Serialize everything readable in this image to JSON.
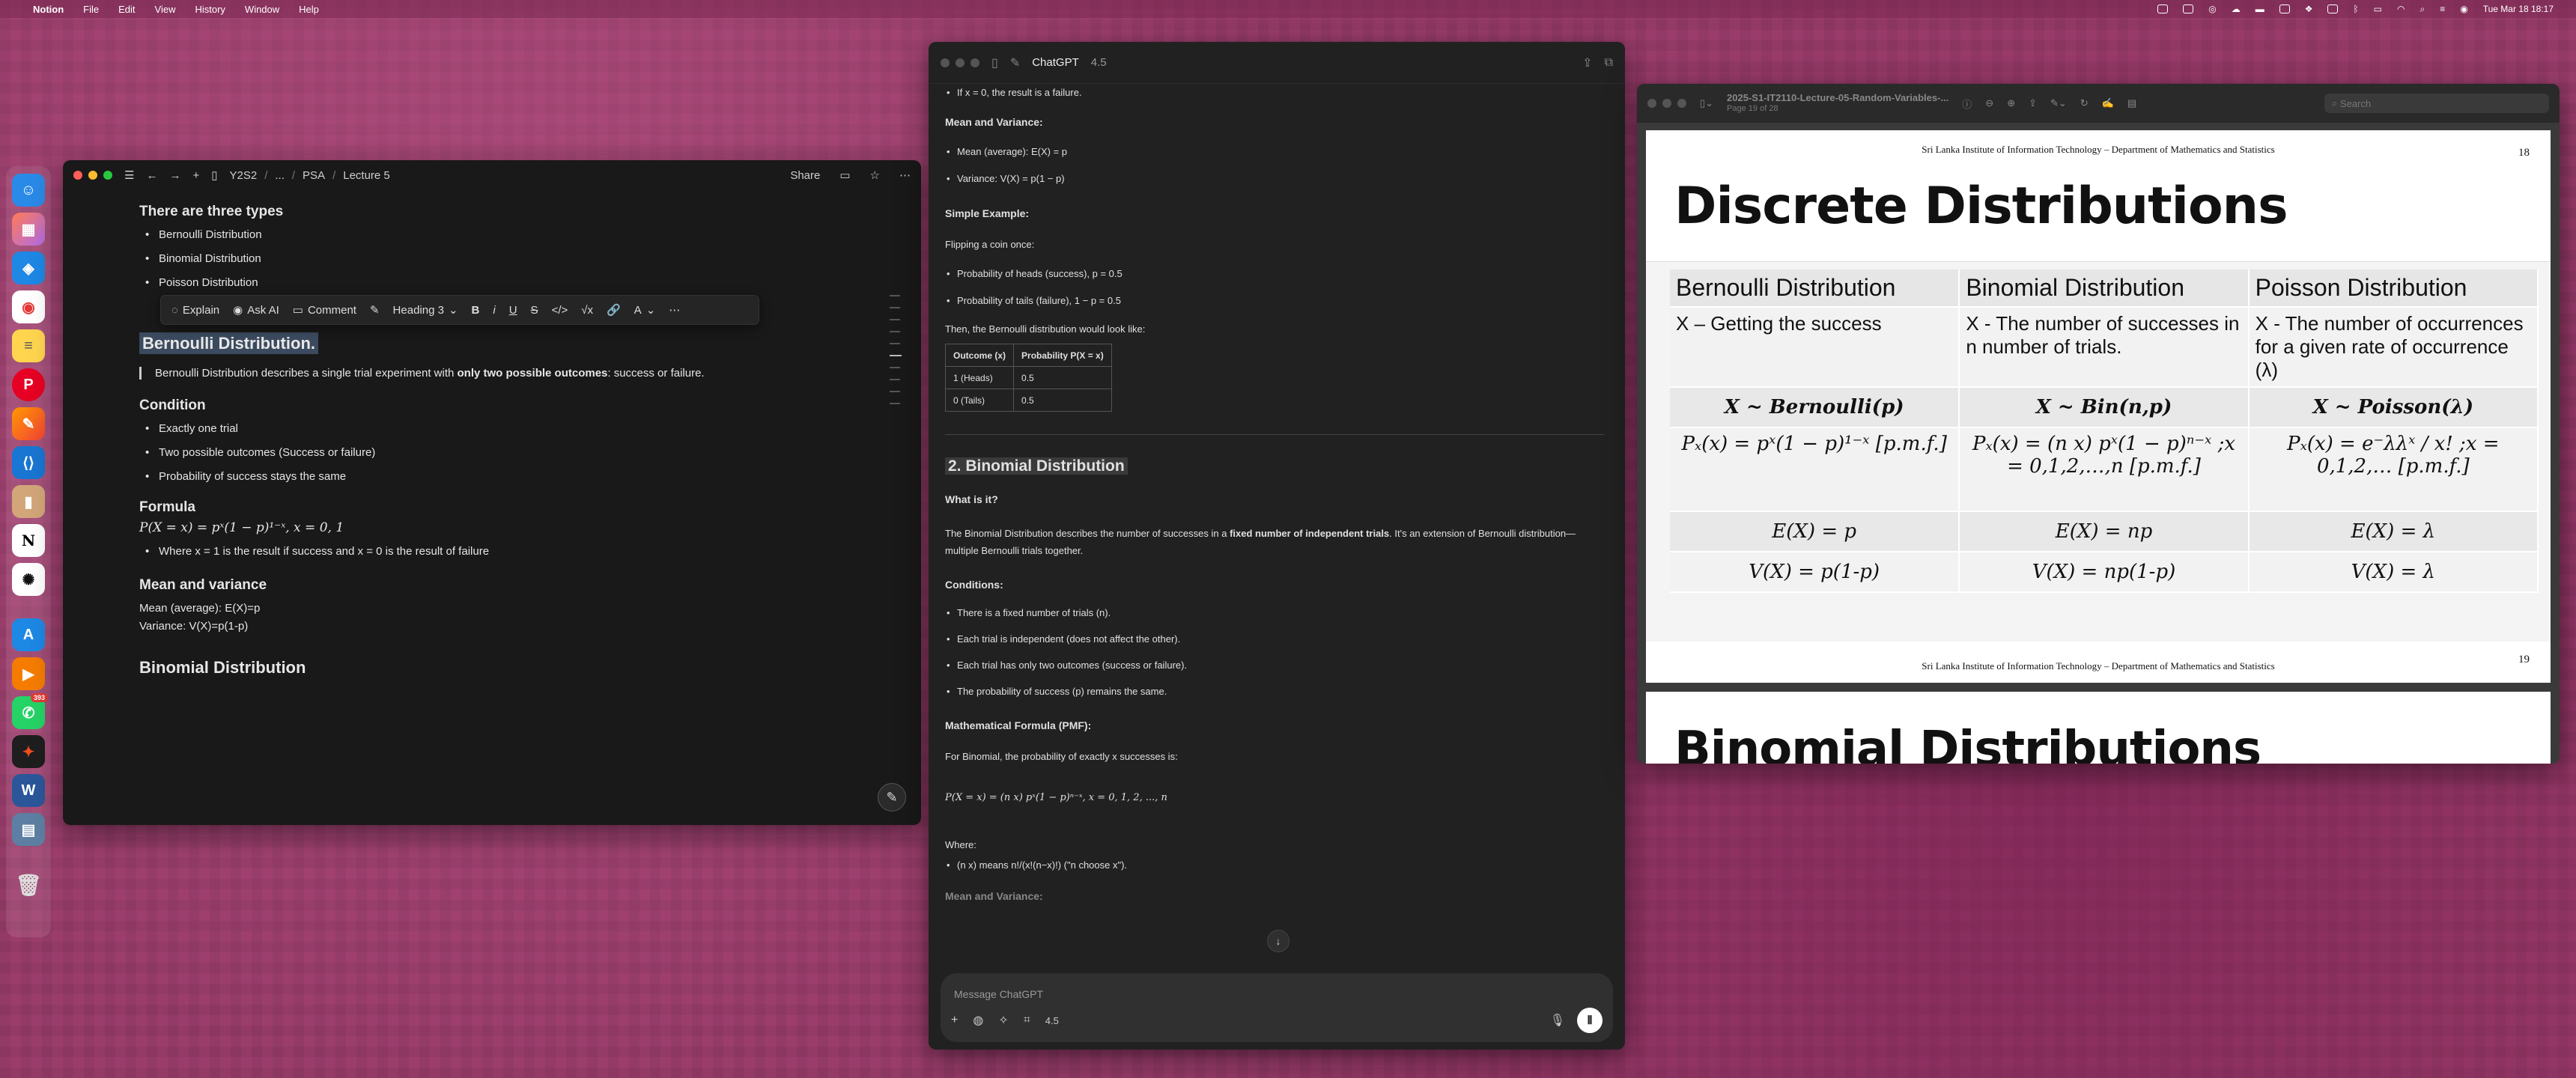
{
  "menubar": {
    "apple": "",
    "app": "Notion",
    "menus": [
      "File",
      "Edit",
      "View",
      "History",
      "Window",
      "Help"
    ],
    "clock": "Tue Mar 18  18:17"
  },
  "dock": {
    "items": [
      "finder",
      "launchpad",
      "safari",
      "chrome",
      "notes",
      "pinterest",
      "pages",
      "vscode",
      "notebook",
      "notion",
      "chatgpt",
      "appstore",
      "clapper",
      "whatsapp",
      "figma",
      "word",
      "preview",
      "trash"
    ],
    "whatsapp_badge": "393"
  },
  "notion": {
    "breadcrumb": [
      "Y2S2",
      "...",
      "PSA",
      "Lecture 5"
    ],
    "share": "Share",
    "heading_types": "There are three types",
    "types": [
      "Bernoulli Distribution",
      "Binomial Distribution",
      "Poisson Distribution"
    ],
    "toolbar": {
      "explain": "Explain",
      "ask_ai": "Ask AI",
      "comment": "Comment",
      "block": "Heading 3",
      "bold": "B",
      "italic": "i",
      "underline": "U",
      "strike": "S",
      "code": "</>",
      "eq": "√x",
      "color": "A"
    },
    "selected_heading": "Bernoulli Distribution.",
    "quote_pre": "Bernoulli Distribution describes a single trial experiment with ",
    "quote_bold": "only two possible outcomes",
    "quote_post": ": success or failure.",
    "condition_heading": "Condition",
    "conditions": [
      "Exactly one trial",
      "Two possible outcomes (Success or failure)",
      "Probability of success stays the same"
    ],
    "formula_heading": "Formula",
    "formula": "P(X = x) = pˣ(1 − p)¹⁻ˣ,    x = 0, 1",
    "formula_note": "Where x = 1 is the result if success and x = 0 is the result of failure",
    "mv_heading": "Mean and variance",
    "mean": "Mean (average): E(X)=p",
    "variance": "Variance: V(X)=p(1-p)",
    "next_heading": "Binomial Distribution"
  },
  "chat": {
    "title": "ChatGPT",
    "model": "4.5",
    "failure_line": "If x = 0, the result is a failure.",
    "mv_heading": "Mean and Variance:",
    "mean": "Mean (average): E(X) = p",
    "variance": "Variance: V(X) = p(1 − p)",
    "simple_heading": "Simple Example:",
    "flip": "Flipping a coin once:",
    "heads": "Probability of heads (success), p = 0.5",
    "tails": "Probability of tails (failure), 1 − p = 0.5",
    "then": "Then, the Bernoulli distribution would look like:",
    "table": {
      "headers": [
        "Outcome (x)",
        "Probability P(X = x)"
      ],
      "rows": [
        [
          "1 (Heads)",
          "0.5"
        ],
        [
          "0 (Tails)",
          "0.5"
        ]
      ]
    },
    "binom_heading": "2. Binomial Distribution",
    "whatis": "What is it?",
    "binom_desc_pre": "The Binomial Distribution describes the number of successes in a ",
    "binom_desc_bold": "fixed number of independent trials",
    "binom_desc_post": ". It's an extension of Bernoulli distribution—multiple Bernoulli trials together.",
    "conditions_heading": "Conditions:",
    "conditions": [
      "There is a fixed number of trials (n).",
      "Each trial is independent (does not affect the other).",
      "Each trial has only two outcomes (success or failure).",
      "The probability of success (p) remains the same."
    ],
    "pmf_heading": "Mathematical Formula (PMF):",
    "pmf_intro": "For Binomial, the probability of exactly x successes is:",
    "pmf": "P(X = x) = (n x) pˣ(1 − p)ⁿ⁻ˣ,    x = 0, 1, 2, ..., n",
    "where": "Where:",
    "choose": "(n x) means n!/(x!(n−x)!) (\"n choose x\").",
    "mv2": "Mean and Variance:",
    "placeholder": "Message ChatGPT",
    "input_model": "4.5"
  },
  "pdf": {
    "filename": "2025-S1-IT2110-Lecture-05-Random-Variables-...",
    "page_info": "Page 19 of 28",
    "search": "Search",
    "header": "Sri Lanka Institute of Information Technology – Department of Mathematics and Statistics",
    "page_num_top": "18",
    "title": "Discrete Distributions",
    "cols": [
      "Bernoulli Distribution",
      "Binomial Distribution",
      "Poisson Distribution"
    ],
    "desc": [
      "X – Getting the success",
      "X - The number of successes in n number of trials.",
      "X - The number of occurrences for a given rate of occurrence (λ)"
    ],
    "notation": [
      "X ~ Bernoulli(p)",
      "X ~ Bin(n,p)",
      "X ~ Poisson(λ)"
    ],
    "pmf": [
      "Pₓ(x) = pˣ(1 − p)¹⁻ˣ [p.m.f.]",
      "Pₓ(x) = (n x) pˣ(1 − p)ⁿ⁻ˣ ;x = 0,1,2,…,n [p.m.f.]",
      "Pₓ(x) = e⁻λλˣ / x!  ;x = 0,1,2,… [p.m.f.]"
    ],
    "mean": [
      "E(X) = p",
      "E(X) = np",
      "E(X) = λ"
    ],
    "var": [
      "V(X) = p(1-p)",
      "V(X) = np(1-p)",
      "V(X) = λ"
    ],
    "footer": "Sri Lanka Institute of Information Technology – Department of Mathematics and Statistics",
    "page_num_bottom": "19",
    "next_title": "Binomial Distributions"
  }
}
